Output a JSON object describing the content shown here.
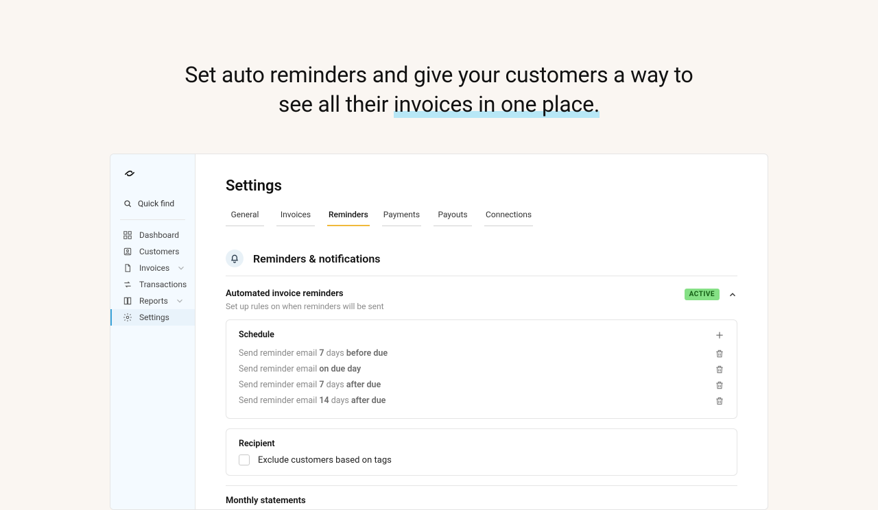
{
  "hero": {
    "line1": "Set auto reminders and give your customers a way to",
    "line2_pre": "see all their ",
    "line2_hl": "invoices in one place."
  },
  "sidebar": {
    "quick_find": "Quick find",
    "items": [
      {
        "label": "Dashboard"
      },
      {
        "label": "Customers"
      },
      {
        "label": "Invoices",
        "expandable": true
      },
      {
        "label": "Transactions"
      },
      {
        "label": "Reports",
        "expandable": true
      },
      {
        "label": "Settings",
        "active": true
      }
    ]
  },
  "page": {
    "title": "Settings",
    "tabs": [
      "General",
      "Invoices",
      "Reminders",
      "Payments",
      "Payouts",
      "Connections"
    ],
    "active_tab_index": 2
  },
  "section": {
    "title": "Reminders & notifications"
  },
  "auto_reminders": {
    "title": "Automated invoice reminders",
    "desc": "Set up rules on when reminders will be sent",
    "badge": "ACTIVE"
  },
  "schedule": {
    "title": "Schedule",
    "rules": [
      {
        "prefix": "Send reminder email ",
        "num": "7",
        "mid": " days ",
        "bold": "before due"
      },
      {
        "prefix": "Send reminder email ",
        "num": "",
        "mid": "",
        "bold": "on due day"
      },
      {
        "prefix": "Send reminder email ",
        "num": "7",
        "mid": " days ",
        "bold": "after due"
      },
      {
        "prefix": "Send reminder email ",
        "num": "14",
        "mid": " days ",
        "bold": "after due"
      }
    ]
  },
  "recipient": {
    "title": "Recipient",
    "exclude_label": "Exclude customers based on tags"
  },
  "monthly": {
    "title": "Monthly statements"
  }
}
